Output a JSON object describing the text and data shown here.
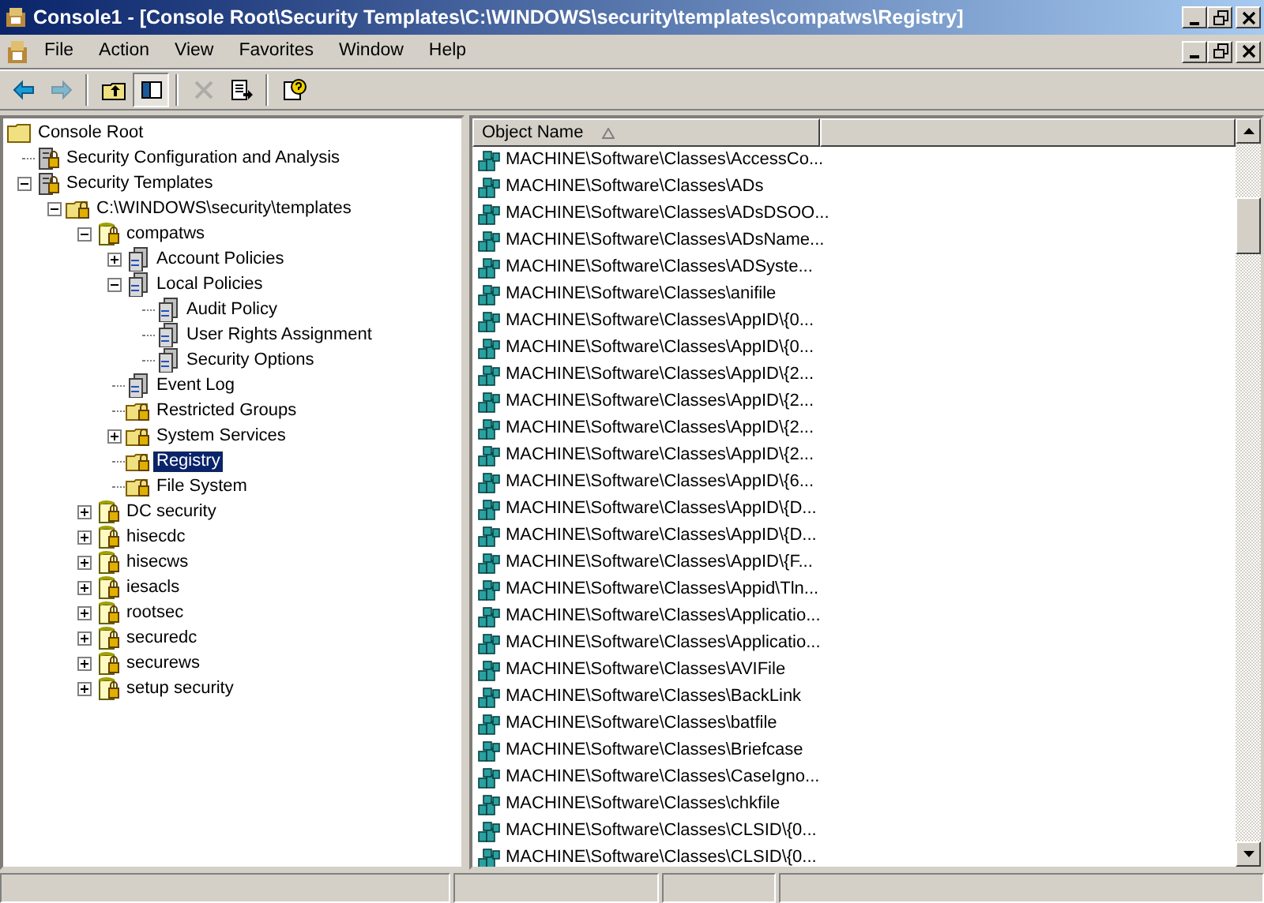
{
  "window": {
    "title": "Console1 - [Console Root\\Security Templates\\C:\\WINDOWS\\security\\templates\\compatws\\Registry]"
  },
  "menu": [
    "File",
    "Action",
    "View",
    "Favorites",
    "Window",
    "Help"
  ],
  "toolbar": [
    {
      "kind": "back",
      "disabled": false,
      "pressed": false
    },
    {
      "kind": "forward",
      "disabled": true,
      "pressed": false
    },
    {
      "kind": "sep"
    },
    {
      "kind": "up",
      "disabled": false,
      "pressed": false
    },
    {
      "kind": "tree",
      "disabled": false,
      "pressed": true
    },
    {
      "kind": "sep"
    },
    {
      "kind": "delete",
      "disabled": true,
      "pressed": false
    },
    {
      "kind": "export",
      "disabled": false,
      "pressed": false
    },
    {
      "kind": "sep"
    },
    {
      "kind": "help",
      "disabled": false,
      "pressed": false
    }
  ],
  "tree": [
    {
      "label": "Console Root",
      "kind": "folder",
      "selected": false,
      "children": [
        {
          "label": "Security Configuration and Analysis",
          "kind": "lockserver",
          "selected": false
        },
        {
          "label": "Security Templates",
          "kind": "lockserver",
          "selected": false,
          "expanded": true,
          "children": [
            {
              "label": "C:\\WINDOWS\\security\\templates",
              "kind": "lockfolder",
              "selected": false,
              "expanded": true,
              "children": [
                {
                  "label": "compatws",
                  "kind": "template",
                  "selected": false,
                  "expanded": true,
                  "children": [
                    {
                      "label": "Account Policies",
                      "kind": "policy",
                      "selected": false,
                      "expanded": false
                    },
                    {
                      "label": "Local Policies",
                      "kind": "policy",
                      "selected": false,
                      "expanded": true,
                      "children": [
                        {
                          "label": "Audit Policy",
                          "kind": "policy",
                          "selected": false
                        },
                        {
                          "label": "User Rights Assignment",
                          "kind": "policy",
                          "selected": false
                        },
                        {
                          "label": "Security Options",
                          "kind": "policy",
                          "selected": false
                        }
                      ]
                    },
                    {
                      "label": "Event Log",
                      "kind": "policy",
                      "selected": false
                    },
                    {
                      "label": "Restricted Groups",
                      "kind": "lockfolder",
                      "selected": false
                    },
                    {
                      "label": "System Services",
                      "kind": "lockfolder",
                      "selected": false,
                      "expanded": false
                    },
                    {
                      "label": "Registry",
                      "kind": "lockfolder",
                      "selected": true
                    },
                    {
                      "label": "File System",
                      "kind": "lockfolder",
                      "selected": false
                    }
                  ]
                },
                {
                  "label": "DC security",
                  "kind": "template",
                  "selected": false,
                  "expanded": false
                },
                {
                  "label": "hisecdc",
                  "kind": "template",
                  "selected": false,
                  "expanded": false
                },
                {
                  "label": "hisecws",
                  "kind": "template",
                  "selected": false,
                  "expanded": false
                },
                {
                  "label": "iesacls",
                  "kind": "template",
                  "selected": false,
                  "expanded": false
                },
                {
                  "label": "rootsec",
                  "kind": "template",
                  "selected": false,
                  "expanded": false
                },
                {
                  "label": "securedc",
                  "kind": "template",
                  "selected": false,
                  "expanded": false
                },
                {
                  "label": "securews",
                  "kind": "template",
                  "selected": false,
                  "expanded": false
                },
                {
                  "label": "setup security",
                  "kind": "template",
                  "selected": false,
                  "expanded": false
                }
              ]
            }
          ]
        }
      ]
    }
  ],
  "list": {
    "columns": [
      "Object Name"
    ],
    "rows": [
      "MACHINE\\Software\\Classes\\AccessCo...",
      "MACHINE\\Software\\Classes\\ADs",
      "MACHINE\\Software\\Classes\\ADsDSOO...",
      "MACHINE\\Software\\Classes\\ADsName...",
      "MACHINE\\Software\\Classes\\ADSyste...",
      "MACHINE\\Software\\Classes\\anifile",
      "MACHINE\\Software\\Classes\\AppID\\{0...",
      "MACHINE\\Software\\Classes\\AppID\\{0...",
      "MACHINE\\Software\\Classes\\AppID\\{2...",
      "MACHINE\\Software\\Classes\\AppID\\{2...",
      "MACHINE\\Software\\Classes\\AppID\\{2...",
      "MACHINE\\Software\\Classes\\AppID\\{2...",
      "MACHINE\\Software\\Classes\\AppID\\{6...",
      "MACHINE\\Software\\Classes\\AppID\\{D...",
      "MACHINE\\Software\\Classes\\AppID\\{D...",
      "MACHINE\\Software\\Classes\\AppID\\{F...",
      "MACHINE\\Software\\Classes\\Appid\\Tln...",
      "MACHINE\\Software\\Classes\\Applicatio...",
      "MACHINE\\Software\\Classes\\Applicatio...",
      "MACHINE\\Software\\Classes\\AVIFile",
      "MACHINE\\Software\\Classes\\BackLink",
      "MACHINE\\Software\\Classes\\batfile",
      "MACHINE\\Software\\Classes\\Briefcase",
      "MACHINE\\Software\\Classes\\CaseIgno...",
      "MACHINE\\Software\\Classes\\chkfile",
      "MACHINE\\Software\\Classes\\CLSID\\{0...",
      "MACHINE\\Software\\Classes\\CLSID\\{0..."
    ]
  }
}
